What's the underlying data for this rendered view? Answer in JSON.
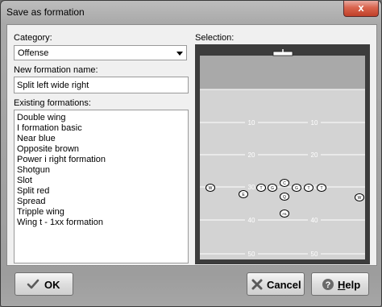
{
  "window": {
    "title": "Save as formation",
    "close_label": "x"
  },
  "category": {
    "label": "Category:",
    "value": "Offense"
  },
  "new_name": {
    "label": "New formation name:",
    "value": "Split left wide right"
  },
  "existing": {
    "label": "Existing formations:",
    "items": [
      "Double wing",
      "I formation basic",
      "Near blue",
      "Opposite brown",
      "Power i right formation",
      "Shotgun",
      "Slot",
      "Split red",
      "Spread",
      "Tripple wing",
      "Wing t - 1xx formation"
    ]
  },
  "selection": {
    "label": "Selection:",
    "yard_labels": [
      "10",
      "20",
      "30",
      "40",
      "50"
    ],
    "players": [
      {
        "glyph": "T",
        "row": "line"
      },
      {
        "glyph": "G",
        "row": "line"
      },
      {
        "glyph": "C",
        "row": "line"
      },
      {
        "glyph": "G",
        "row": "line"
      },
      {
        "glyph": "T",
        "row": "line"
      },
      {
        "glyph": "T",
        "row": "line"
      },
      {
        "glyph": "E",
        "row": "line"
      },
      {
        "glyph": "Q",
        "row": "backfield"
      },
      {
        "glyph": "FB",
        "row": "backfield"
      },
      {
        "glyph": "W",
        "row": "wide"
      },
      {
        "glyph": "W",
        "row": "wide"
      }
    ]
  },
  "buttons": {
    "ok": "OK",
    "cancel": "Cancel",
    "help_prefix": "",
    "help_underlined": "H",
    "help_rest": "elp"
  },
  "colors": {
    "field": "#d3d3d3",
    "endzone": "#a9a9a9",
    "border": "#3c3c3c",
    "button_text": "#000000"
  }
}
